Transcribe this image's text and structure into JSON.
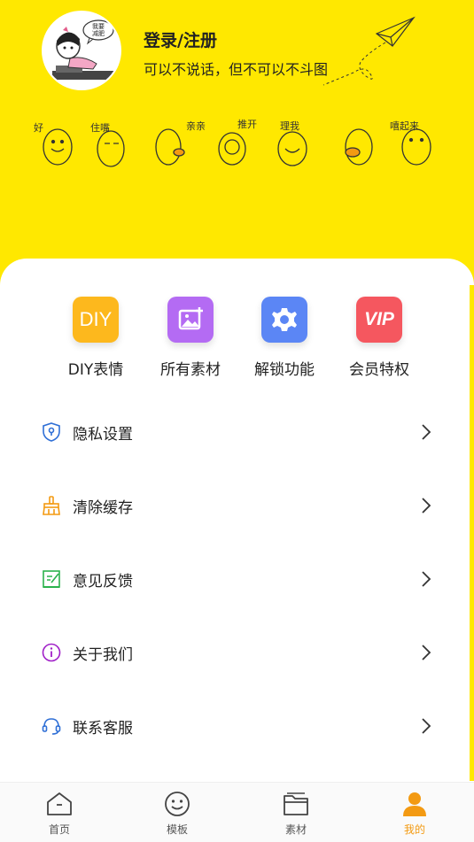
{
  "profile": {
    "title": "登录/注册",
    "subtitle": "可以不说话，但不可以不斗图",
    "avatar_bubble": "我要\n减肥"
  },
  "stickers": [
    "好",
    "住嘴",
    "亲亲",
    "推开",
    "理我",
    "嘻起来"
  ],
  "quick_actions": [
    {
      "label": "DIY表情",
      "icon": "diy-icon",
      "text": "DIY",
      "color": "#fdb81d"
    },
    {
      "label": "所有素材",
      "icon": "image-add-icon",
      "color": "#b46bf3"
    },
    {
      "label": "解锁功能",
      "icon": "gear-icon",
      "color": "#5b86f5"
    },
    {
      "label": "会员特权",
      "icon": "vip-icon",
      "text": "VIP",
      "color": "#f5575f"
    }
  ],
  "menu": [
    {
      "label": "隐私设置",
      "icon": "shield-lock-icon",
      "color": "#2f6fd6"
    },
    {
      "label": "清除缓存",
      "icon": "broom-icon",
      "color": "#f39a12"
    },
    {
      "label": "意见反馈",
      "icon": "feedback-edit-icon",
      "color": "#2bb24c"
    },
    {
      "label": "关于我们",
      "icon": "info-icon",
      "color": "#a020c8"
    },
    {
      "label": "联系客服",
      "icon": "headset-icon",
      "color": "#2f6fd6"
    }
  ],
  "tabs": [
    {
      "label": "首页",
      "icon": "home-icon",
      "active": false
    },
    {
      "label": "模板",
      "icon": "smile-icon",
      "active": false
    },
    {
      "label": "素材",
      "icon": "folder-icon",
      "active": false
    },
    {
      "label": "我的",
      "icon": "user-icon",
      "active": true
    }
  ],
  "colors": {
    "header_bg": "#ffe800",
    "active_tab": "#f39a12"
  }
}
